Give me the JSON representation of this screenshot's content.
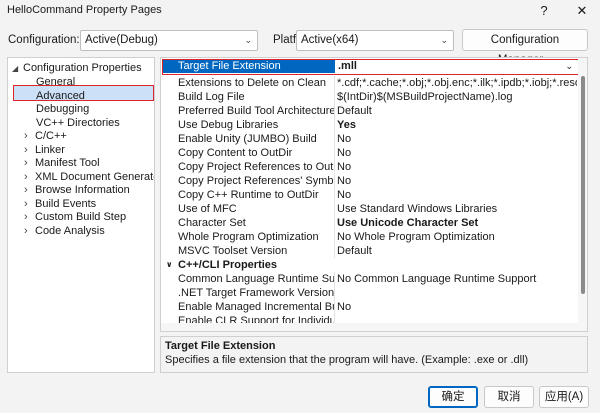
{
  "window": {
    "title": "HelloCommand Property Pages",
    "help": "?",
    "close": "✕"
  },
  "config": {
    "config_label": "Configuration:",
    "config_value": "Active(Debug)",
    "platform_label": "Platform:",
    "platform_value": "Active(x64)",
    "manager_button": "Configuration Manager..."
  },
  "tree": {
    "root": "Configuration Properties",
    "items": [
      {
        "label": "General",
        "expandable": false
      },
      {
        "label": "Advanced",
        "expandable": false,
        "selected": true
      },
      {
        "label": "Debugging",
        "expandable": false
      },
      {
        "label": "VC++ Directories",
        "expandable": false
      },
      {
        "label": "C/C++",
        "expandable": true
      },
      {
        "label": "Linker",
        "expandable": true
      },
      {
        "label": "Manifest Tool",
        "expandable": true
      },
      {
        "label": "XML Document Generator",
        "expandable": true
      },
      {
        "label": "Browse Information",
        "expandable": true
      },
      {
        "label": "Build Events",
        "expandable": true
      },
      {
        "label": "Custom Build Step",
        "expandable": true
      },
      {
        "label": "Code Analysis",
        "expandable": true
      }
    ]
  },
  "grid": {
    "selected": {
      "name": "Target File Extension",
      "value": ".mll"
    },
    "rows": [
      {
        "name": "Extensions to Delete on Clean",
        "value": "*.cdf;*.cache;*.obj;*.obj.enc;*.ilk;*.ipdb;*.iobj;*.resources"
      },
      {
        "name": "Build Log File",
        "value": "$(IntDir)$(MSBuildProjectName).log"
      },
      {
        "name": "Preferred Build Tool Architecture",
        "value": "Default"
      },
      {
        "name": "Use Debug Libraries",
        "value": "Yes",
        "bold": true
      },
      {
        "name": "Enable Unity (JUMBO) Build",
        "value": "No"
      },
      {
        "name": "Copy Content to OutDir",
        "value": "No"
      },
      {
        "name": "Copy Project References to OutDir",
        "value": "No"
      },
      {
        "name": "Copy Project References' Symbols",
        "value": "No"
      },
      {
        "name": "Copy C++ Runtime to OutDir",
        "value": "No"
      },
      {
        "name": "Use of MFC",
        "value": "Use Standard Windows Libraries"
      },
      {
        "name": "Character Set",
        "value": "Use Unicode Character Set",
        "bold": true
      },
      {
        "name": "Whole Program Optimization",
        "value": "No Whole Program Optimization"
      },
      {
        "name": "MSVC Toolset Version",
        "value": "Default"
      }
    ],
    "category": "C++/CLI Properties",
    "cli_rows": [
      {
        "name": "Common Language Runtime Support",
        "value": "No Common Language Runtime Support"
      },
      {
        "name": ".NET Target Framework Version",
        "value": ""
      },
      {
        "name": "Enable Managed Incremental Build",
        "value": "No"
      },
      {
        "name": "Enable CLR Support for Individual Files",
        "value": ""
      }
    ]
  },
  "description": {
    "title": "Target File Extension",
    "text": "Specifies a file extension that the program will have. (Example: .exe or .dll)"
  },
  "footer": {
    "ok": "确定",
    "cancel": "取消",
    "apply": "应用(A)"
  },
  "colors": {
    "accent": "#0067c0",
    "highlight_border": "#d9252b"
  }
}
